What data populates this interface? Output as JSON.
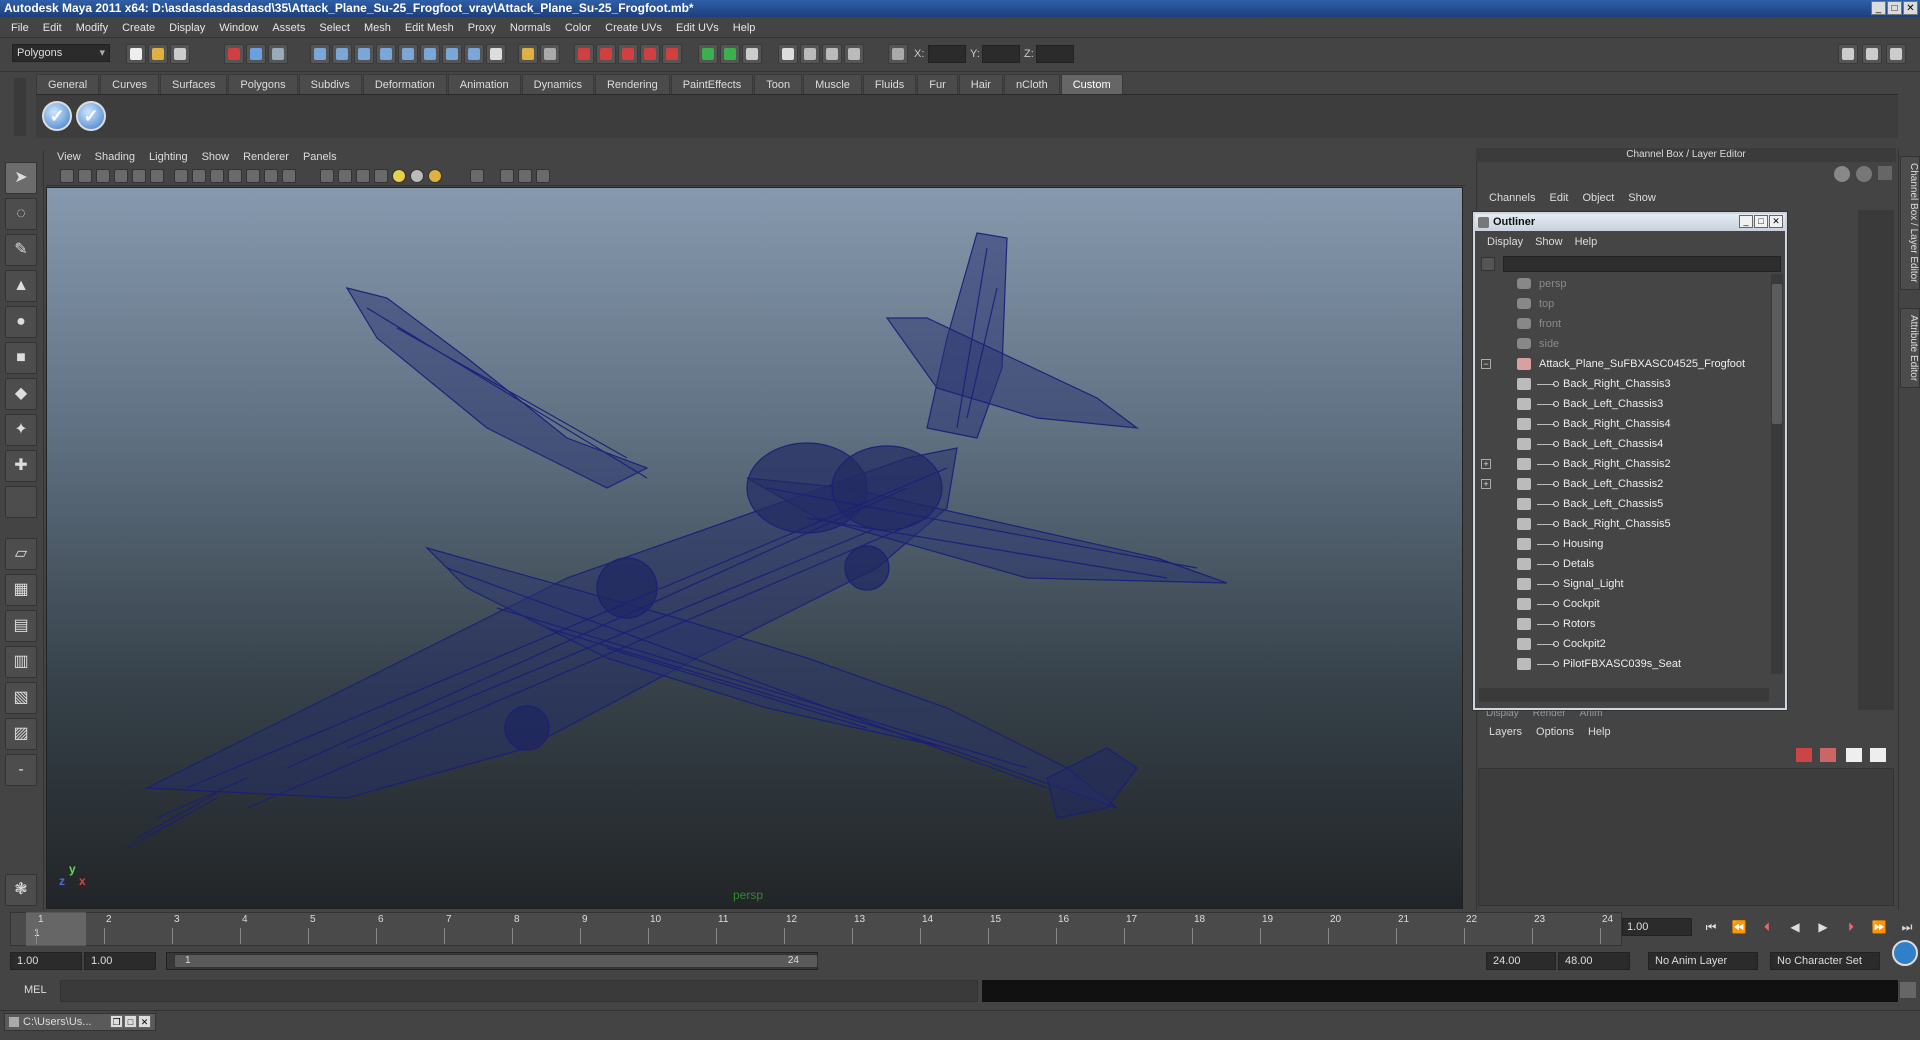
{
  "window": {
    "title": "Autodesk Maya 2011 x64: D:\\asdasdasdasdasd\\35\\Attack_Plane_Su-25_Frogfoot_vray\\Attack_Plane_Su-25_Frogfoot.mb*"
  },
  "menubar": [
    "File",
    "Edit",
    "Modify",
    "Create",
    "Display",
    "Window",
    "Assets",
    "Select",
    "Mesh",
    "Edit Mesh",
    "Proxy",
    "Normals",
    "Color",
    "Create UVs",
    "Edit UVs",
    "Help"
  ],
  "status": {
    "mode": "Polygons",
    "x_label": "X:",
    "y_label": "Y:",
    "z_label": "Z:"
  },
  "shelf": {
    "tabs": [
      "General",
      "Curves",
      "Surfaces",
      "Polygons",
      "Subdivs",
      "Deformation",
      "Animation",
      "Dynamics",
      "Rendering",
      "PaintEffects",
      "Toon",
      "Muscle",
      "Fluids",
      "Fur",
      "Hair",
      "nCloth",
      "Custom"
    ],
    "active": "Custom"
  },
  "viewport": {
    "menu": [
      "View",
      "Shading",
      "Lighting",
      "Show",
      "Renderer",
      "Panels"
    ],
    "camera": "persp",
    "axis_x": "x",
    "axis_y": "y",
    "axis_z": "z"
  },
  "channelbox": {
    "title": "Channel Box / Layer Editor",
    "menu": [
      "Channels",
      "Edit",
      "Object",
      "Show"
    ],
    "side_tabs": [
      "Channel Box / Layer Editor",
      "Attribute Editor"
    ]
  },
  "outliner": {
    "title": "Outliner",
    "menu": [
      "Display",
      "Show",
      "Help"
    ],
    "cameras": [
      "persp",
      "top",
      "front",
      "side"
    ],
    "root": "Attack_Plane_SuFBXASC04525_Frogfoot",
    "children": [
      "Back_Right_Chassis3",
      "Back_Left_Chassis3",
      "Back_Right_Chassis4",
      "Back_Left_Chassis4",
      "Back_Right_Chassis2",
      "Back_Left_Chassis2",
      "Back_Left_Chassis5",
      "Back_Right_Chassis5",
      "Housing",
      "Detals",
      "Signal_Light",
      "Cockpit",
      "Rotors",
      "Cockpit2",
      "PilotFBXASC039s_Seat"
    ]
  },
  "layers": {
    "menu": [
      "Layers",
      "Options",
      "Help"
    ],
    "hidden_tabs": [
      "Display",
      "Render",
      "Anim"
    ]
  },
  "timeline": {
    "ticks": [
      "1",
      "2",
      "3",
      "4",
      "5",
      "6",
      "7",
      "8",
      "9",
      "10",
      "11",
      "12",
      "13",
      "14",
      "15",
      "16",
      "17",
      "18",
      "19",
      "20",
      "21",
      "22",
      "23",
      "24"
    ],
    "current": "1.00",
    "current_marker": "1"
  },
  "range": {
    "start": "1.00",
    "anim_start": "1.00",
    "slider_start": "1",
    "slider_end": "24",
    "end": "24.00",
    "anim_end": "48.00",
    "anim_layer": "No Anim Layer",
    "char_set": "No Character Set"
  },
  "command": {
    "label": "MEL"
  },
  "taskbar": {
    "item": "C:\\Users\\Us..."
  }
}
